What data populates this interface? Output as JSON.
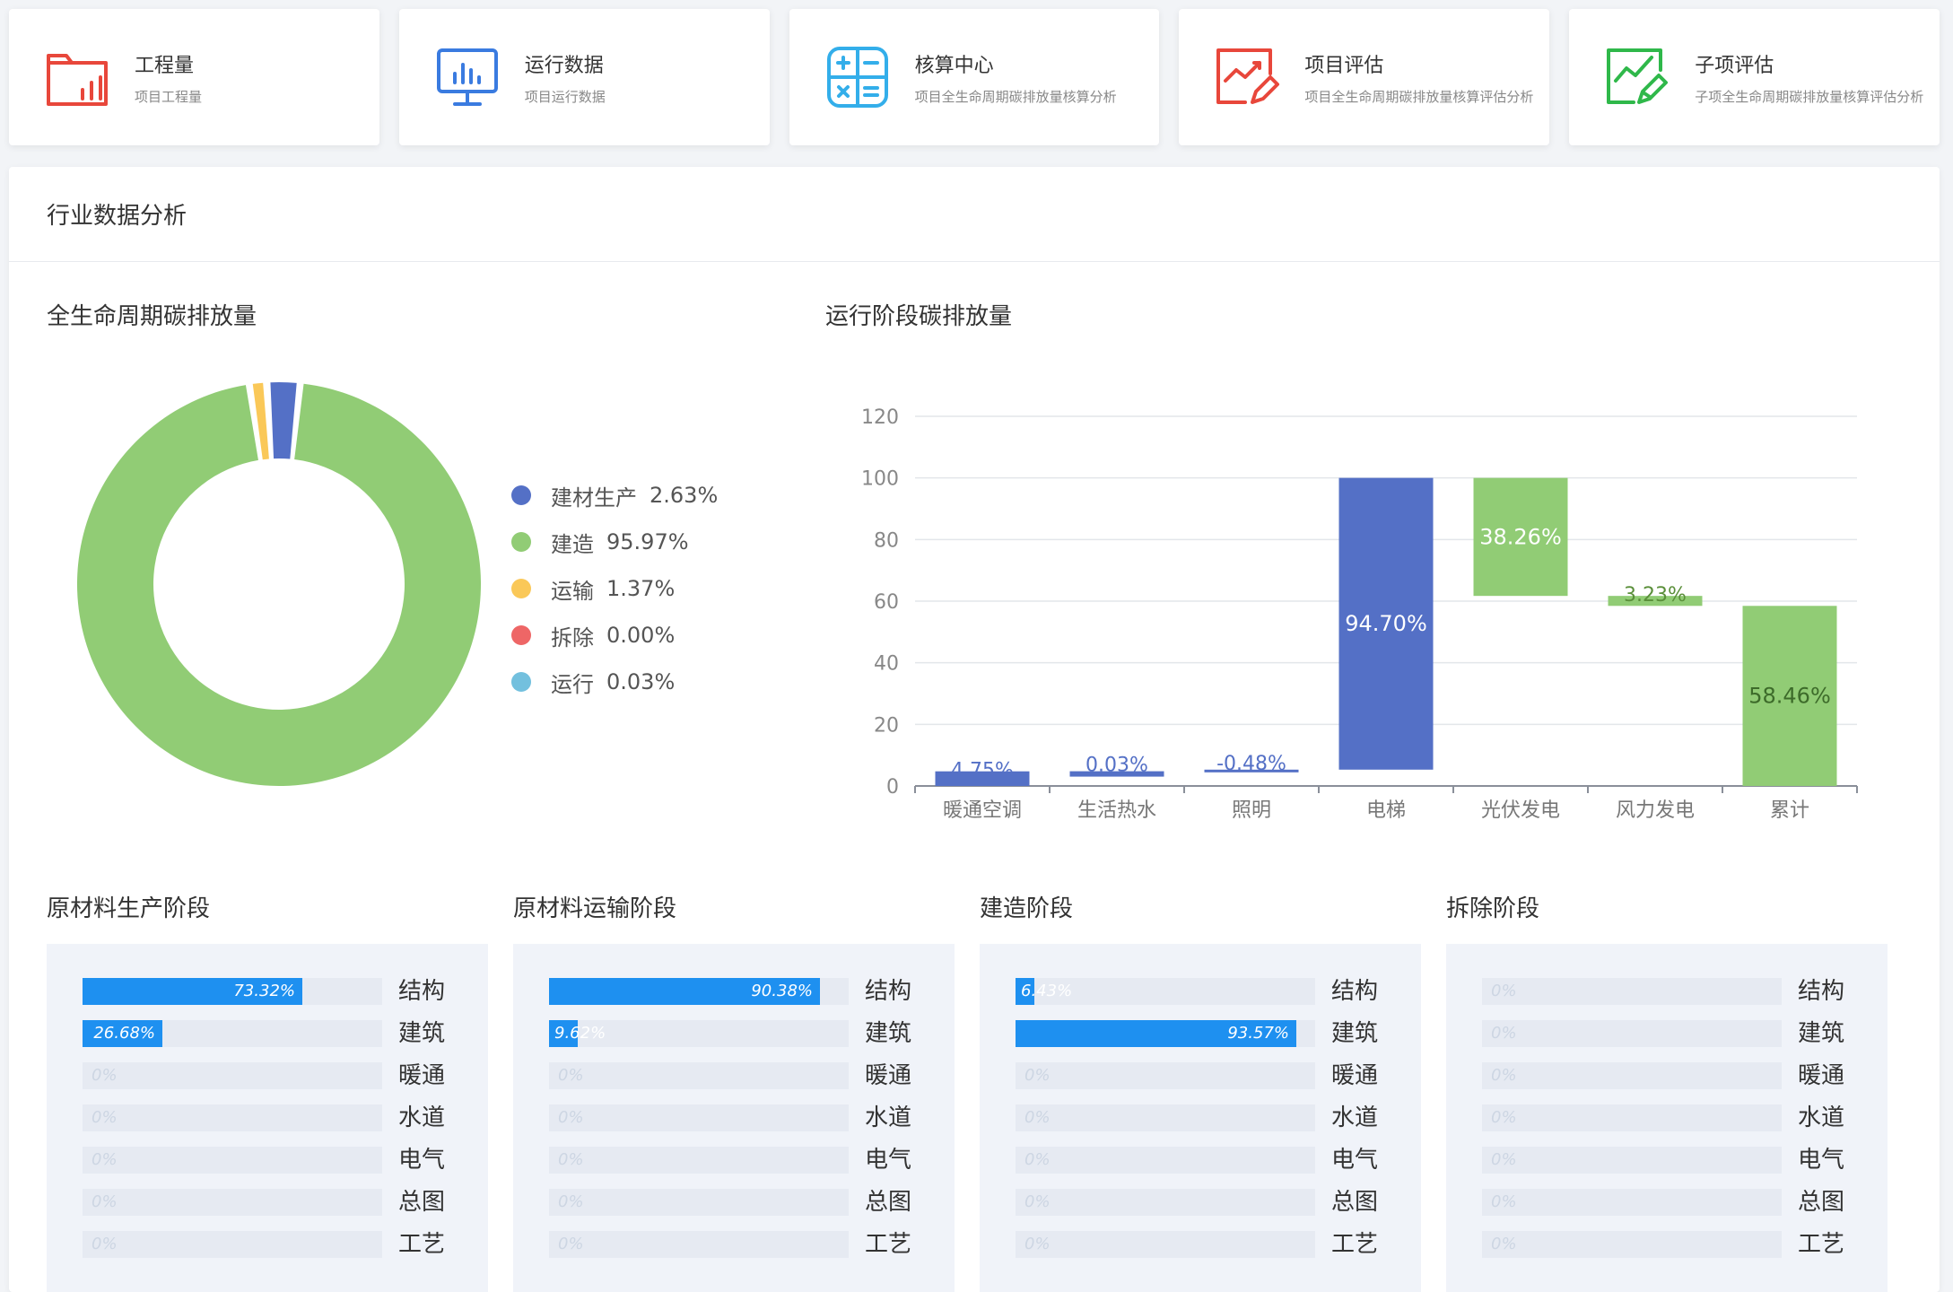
{
  "colors": {
    "blue": "#5470c6",
    "green": "#91cc75",
    "yellow": "#fac858",
    "red": "#ee6666",
    "cyan": "#73c0de",
    "bar": "#1e90f0",
    "card_red": "#e8473b",
    "card_blue": "#3a7be0",
    "card_cyan": "#33aeea",
    "card_green": "#2fb84a"
  },
  "cards": [
    {
      "title": "工程量",
      "subtitle": "项目工程量",
      "icon": "folder-chart-icon"
    },
    {
      "title": "运行数据",
      "subtitle": "项目运行数据",
      "icon": "monitor-chart-icon"
    },
    {
      "title": "核算中心",
      "subtitle": "项目全生命周期碳排放量核算分析",
      "icon": "calculator-icon"
    },
    {
      "title": "项目评估",
      "subtitle": "项目全生命周期碳排放量核算评估分析",
      "icon": "chart-edit-icon"
    },
    {
      "title": "子项评估",
      "subtitle": "子项全生命周期碳排放量核算评估分析",
      "icon": "chart-check-icon"
    }
  ],
  "panel": {
    "title": "行业数据分析"
  },
  "lifecycle": {
    "title": "全生命周期碳排放量",
    "legend": [
      {
        "name": "建材生产",
        "value": "2.63%",
        "color": "#5470c6"
      },
      {
        "name": "建造",
        "value": "95.97%",
        "color": "#91cc75"
      },
      {
        "name": "运输",
        "value": "1.37%",
        "color": "#fac858"
      },
      {
        "name": "拆除",
        "value": "0.00%",
        "color": "#ee6666"
      },
      {
        "name": "运行",
        "value": "0.03%",
        "color": "#73c0de"
      }
    ]
  },
  "operation": {
    "title": "运行阶段碳排放量"
  },
  "chart_data": [
    {
      "type": "pie",
      "title": "全生命周期碳排放量",
      "labels": [
        "建材生产",
        "建造",
        "运输",
        "拆除",
        "运行"
      ],
      "values": [
        2.63,
        95.97,
        1.37,
        0.0,
        0.03
      ],
      "colors": [
        "#5470c6",
        "#91cc75",
        "#fac858",
        "#ee6666",
        "#73c0de"
      ],
      "donut": true,
      "legend": "right"
    },
    {
      "type": "bar",
      "title": "运行阶段碳排放量",
      "categories": [
        "暖通空调",
        "生活热水",
        "照明",
        "电梯",
        "光伏发电",
        "风力发电",
        "累计"
      ],
      "ylim": [
        0,
        120
      ],
      "yticks": [
        0,
        20,
        40,
        60,
        80,
        100,
        120
      ],
      "series": [
        {
          "base": 0,
          "top": 4.75,
          "label": "4.75%",
          "color": "#5470c6"
        },
        {
          "base": 4.75,
          "top": 4.78,
          "label": "0.03%",
          "color": "#5470c6"
        },
        {
          "base": 5.3,
          "top": 5.3,
          "label": "-0.48%",
          "color": "#5470c6"
        },
        {
          "base": 5.3,
          "top": 100,
          "label": "94.70%",
          "color": "#5470c6"
        },
        {
          "base": 61.7,
          "top": 100,
          "label": "38.26%",
          "color": "#91cc75"
        },
        {
          "base": 58.46,
          "top": 61.7,
          "label": "3.23%",
          "color": "#91cc75"
        },
        {
          "base": 0,
          "top": 58.46,
          "label": "58.46%",
          "color": "#91cc75"
        }
      ],
      "grid": true
    }
  ],
  "stages": [
    {
      "title": "原材料生产阶段",
      "rows": [
        {
          "label": "结构",
          "value": 73.32,
          "text": "73.32%"
        },
        {
          "label": "建筑",
          "value": 26.68,
          "text": "26.68%"
        },
        {
          "label": "暖通",
          "value": 0,
          "text": "0%"
        },
        {
          "label": "水道",
          "value": 0,
          "text": "0%"
        },
        {
          "label": "电气",
          "value": 0,
          "text": "0%"
        },
        {
          "label": "总图",
          "value": 0,
          "text": "0%"
        },
        {
          "label": "工艺",
          "value": 0,
          "text": "0%"
        }
      ]
    },
    {
      "title": "原材料运输阶段",
      "rows": [
        {
          "label": "结构",
          "value": 90.38,
          "text": "90.38%"
        },
        {
          "label": "建筑",
          "value": 9.62,
          "text": "9.62%"
        },
        {
          "label": "暖通",
          "value": 0,
          "text": "0%"
        },
        {
          "label": "水道",
          "value": 0,
          "text": "0%"
        },
        {
          "label": "电气",
          "value": 0,
          "text": "0%"
        },
        {
          "label": "总图",
          "value": 0,
          "text": "0%"
        },
        {
          "label": "工艺",
          "value": 0,
          "text": "0%"
        }
      ]
    },
    {
      "title": "建造阶段",
      "rows": [
        {
          "label": "结构",
          "value": 6.43,
          "text": "6.43%"
        },
        {
          "label": "建筑",
          "value": 93.57,
          "text": "93.57%"
        },
        {
          "label": "暖通",
          "value": 0,
          "text": "0%"
        },
        {
          "label": "水道",
          "value": 0,
          "text": "0%"
        },
        {
          "label": "电气",
          "value": 0,
          "text": "0%"
        },
        {
          "label": "总图",
          "value": 0,
          "text": "0%"
        },
        {
          "label": "工艺",
          "value": 0,
          "text": "0%"
        }
      ]
    },
    {
      "title": "拆除阶段",
      "rows": [
        {
          "label": "结构",
          "value": 0,
          "text": "0%"
        },
        {
          "label": "建筑",
          "value": 0,
          "text": "0%"
        },
        {
          "label": "暖通",
          "value": 0,
          "text": "0%"
        },
        {
          "label": "水道",
          "value": 0,
          "text": "0%"
        },
        {
          "label": "电气",
          "value": 0,
          "text": "0%"
        },
        {
          "label": "总图",
          "value": 0,
          "text": "0%"
        },
        {
          "label": "工艺",
          "value": 0,
          "text": "0%"
        }
      ]
    }
  ]
}
